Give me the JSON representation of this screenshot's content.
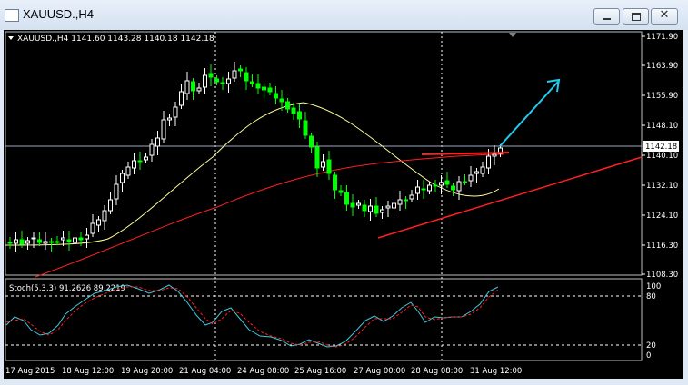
{
  "window": {
    "title": "XAUUSD.,H4",
    "close_glyph": "✕"
  },
  "header": {
    "symbol_line": "XAUUSD.,H4  1141.60 1143.28 1140.18 1142.18"
  },
  "price_axis": {
    "ticks": [
      "1171.90",
      "1163.90",
      "1155.90",
      "1148.10",
      "1140.10",
      "1132.10",
      "1124.10",
      "1116.30",
      "1108.30"
    ],
    "current_price": "1142.18"
  },
  "stoch": {
    "label": "Stoch(5,3,3) 91.2626 89.2219",
    "levels": [
      "100",
      "80",
      "20",
      "0"
    ]
  },
  "time_axis": {
    "labels": [
      "17 Aug 2015",
      "18 Aug 12:00",
      "19 Aug 20:00",
      "21 Aug 04:00",
      "24 Aug 08:00",
      "25 Aug 16:00",
      "27 Aug 00:00",
      "28 Aug 08:00",
      "31 Aug 12:00"
    ]
  },
  "colors": {
    "background": "#000000",
    "bull_candle": "#ffffff",
    "bear_candle": "#00ff00",
    "fast_ma": "#ffff99",
    "slow_ma": "#ff2020",
    "trend_arrow": "#22ccee",
    "stoch_main": "#40c8e0",
    "stoch_signal": "#ff2020"
  }
}
